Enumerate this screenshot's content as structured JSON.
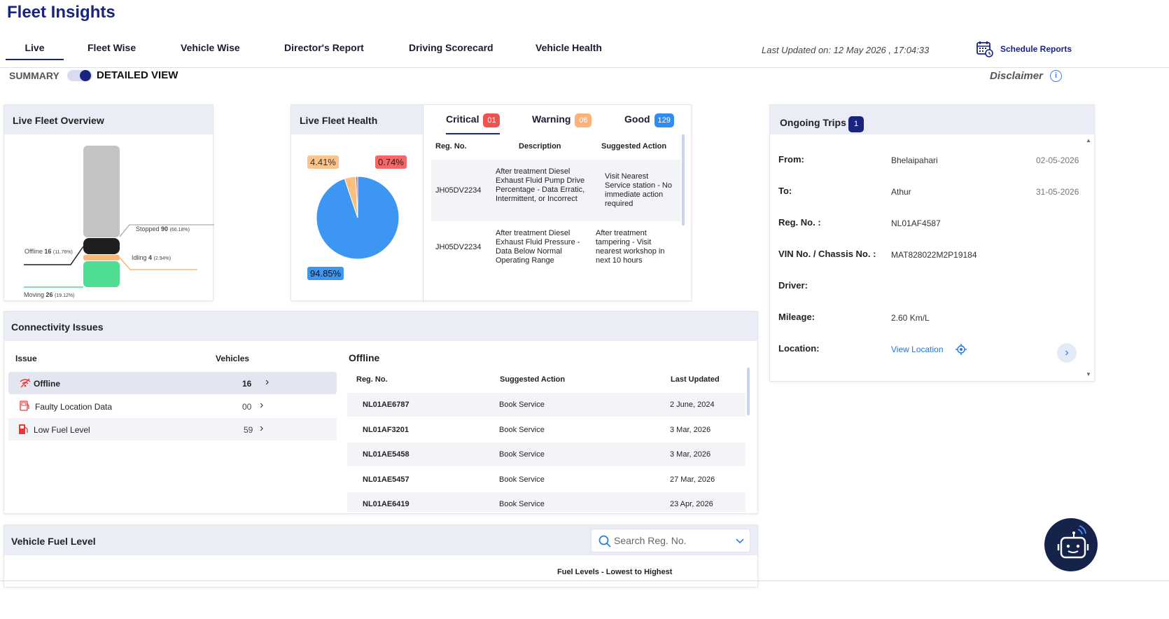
{
  "app": {
    "title": "Fleet Insights"
  },
  "tabs": [
    {
      "label": "Live"
    },
    {
      "label": "Fleet Wise"
    },
    {
      "label": "Vehicle Wise"
    },
    {
      "label": "Director's Report"
    },
    {
      "label": "Driving Scorecard"
    },
    {
      "label": "Vehicle Health"
    }
  ],
  "header": {
    "last_updated": "Last Updated on: 12 May 2026 , 17:04:33",
    "schedule_reports": "Schedule Reports",
    "summary_label": "SUMMARY",
    "detailed_label": "DETAILED VIEW",
    "detailed_view_on": true,
    "disclaimer": "Disclaimer"
  },
  "live_fleet_overview": {
    "title": "Live Fleet Overview",
    "segments": [
      {
        "name": "Stopped",
        "count": "90",
        "pct": "(66.18%)",
        "color": "#c4c4c4"
      },
      {
        "name": "Offline",
        "count": "16",
        "pct": "(11.76%)",
        "color": "#1f1f1f"
      },
      {
        "name": "Idling",
        "count": "4",
        "pct": "(2.94%)",
        "color": "#f9b97a"
      },
      {
        "name": "Moving",
        "count": "26",
        "pct": "(19.12%)",
        "color": "#4fdc93"
      }
    ]
  },
  "live_fleet_health": {
    "title": "Live Fleet Health",
    "tabs": [
      {
        "label": "Critical",
        "count": "01",
        "color": "#ef5350"
      },
      {
        "label": "Warning",
        "count": "06",
        "color": "#ffb277"
      },
      {
        "label": "Good",
        "count": "129",
        "color": "#2f8cf0"
      }
    ],
    "chart_data": {
      "type": "pie",
      "categories": [
        "Good",
        "Warning",
        "Critical"
      ],
      "values": [
        94.85,
        4.41,
        0.74
      ],
      "labels": [
        "94.85%",
        "4.41%",
        "0.74%"
      ],
      "colors": [
        "#3d97f2",
        "#f9c07e",
        "#ef5350"
      ]
    },
    "table": {
      "headers": [
        "Reg. No.",
        "Description",
        "Suggested Action"
      ],
      "rows": [
        {
          "reg": "JH05DV2234",
          "description": "After treatment Diesel Exhaust Fluid Pump Drive Percentage - Data Erratic, Intermittent, or Incorrect",
          "action": "Visit Nearest Service station - No immediate action required"
        },
        {
          "reg": "JH05DV2234",
          "description": "After treatment Diesel Exhaust Fluid Pressure - Data Below Normal Operating Range",
          "action": "After treatment tampering - Visit nearest workshop in next 10 hours"
        }
      ]
    }
  },
  "ongoing_trips": {
    "title": "Ongoing Trips",
    "count": "1",
    "fields": {
      "from_label": "From:",
      "from": "Bhelaipahari",
      "from_date": "02-05-2026",
      "to_label": "To:",
      "to": "Athur",
      "to_date": "31-05-2026",
      "reg_label": "Reg. No. :",
      "reg": "NL01AF4587",
      "vin_label": "VIN No. / Chassis No. :",
      "vin": "MAT828022M2P19184",
      "driver_label": "Driver:",
      "mileage_label": "Mileage:",
      "mileage": "2.60 Km/L",
      "location_label": "Location:",
      "location_link": "View Location"
    }
  },
  "connectivity": {
    "title": "Connectivity Issues",
    "issue_header": "Issue",
    "vehicles_header": "Vehicles",
    "issues": [
      {
        "label": "Offline",
        "count": "16"
      },
      {
        "label": "Faulty Location Data",
        "count": "00"
      },
      {
        "label": "Low Fuel Level",
        "count": "59"
      }
    ],
    "offline": {
      "title": "Offline",
      "headers": [
        "Reg. No.",
        "Suggested Action",
        "Last Updated"
      ],
      "rows": [
        {
          "reg": "NL01AE6787",
          "action": "Book Service",
          "updated": "2 June, 2024"
        },
        {
          "reg": "NL01AF3201",
          "action": "Book Service",
          "updated": "3 Mar, 2026"
        },
        {
          "reg": "NL01AE5458",
          "action": "Book Service",
          "updated": "3 Mar, 2026"
        },
        {
          "reg": "NL01AE5457",
          "action": "Book Service",
          "updated": "27 Mar, 2026"
        },
        {
          "reg": "NL01AE6419",
          "action": "Book Service",
          "updated": "23 Apr, 2026"
        }
      ]
    }
  },
  "fuel": {
    "title": "Vehicle Fuel Level",
    "search_placeholder": "Search Reg. No.",
    "subtitle": "Fuel Levels - Lowest to Highest"
  }
}
